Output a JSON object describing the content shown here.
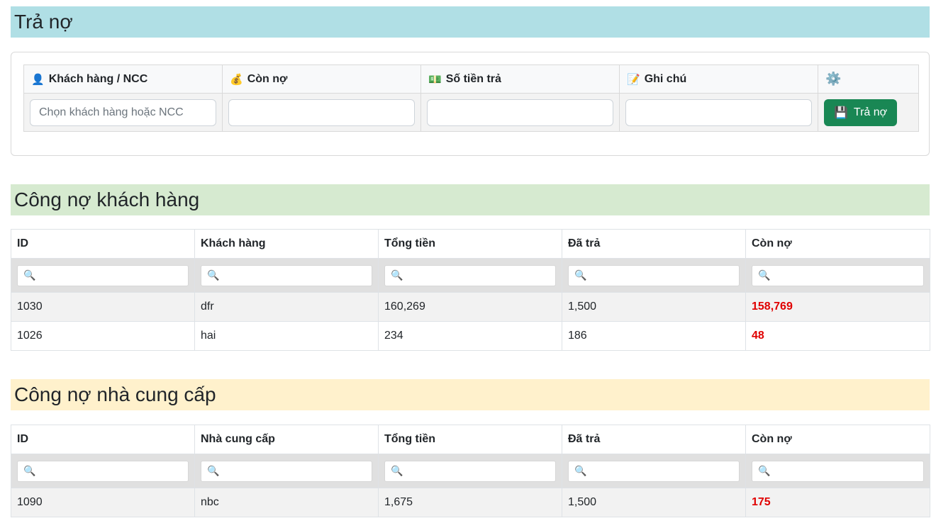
{
  "payment": {
    "title": "Trả nợ",
    "columns": [
      {
        "icon": "👤",
        "icon_name": "user-icon",
        "label": "Khách hàng / NCC"
      },
      {
        "icon": "💰",
        "icon_name": "money-bag-icon",
        "label": "Còn nợ"
      },
      {
        "icon": "💵",
        "icon_name": "banknote-icon",
        "label": "Số tiền trả"
      },
      {
        "icon": "📝",
        "icon_name": "memo-icon",
        "label": "Ghi chú"
      }
    ],
    "settings_icon": "⚙️",
    "customer_placeholder": "Chọn khách hàng hoặc NCC",
    "remaining_value": "",
    "amount_value": "",
    "note_value": "",
    "submit_icon": "💾",
    "submit_label": "Trả nợ",
    "submit_color": "#198754"
  },
  "customer_debt": {
    "title": "Công nợ khách hàng",
    "headers": [
      "ID",
      "Khách hàng",
      "Tổng tiền",
      "Đã trả",
      "Còn nợ"
    ],
    "rows": [
      [
        "1030",
        "dfr",
        "160,269",
        "1,500",
        "158,769"
      ],
      [
        "1026",
        "hai",
        "234",
        "186",
        "48"
      ]
    ]
  },
  "supplier_debt": {
    "title": "Công nợ nhà cung cấp",
    "headers": [
      "ID",
      "Nhà cung cấp",
      "Tổng tiền",
      "Đã trả",
      "Còn nợ"
    ],
    "rows": [
      [
        "1090",
        "nbc",
        "1,675",
        "1,500",
        "175"
      ]
    ]
  },
  "colors": {
    "pay_header_bg": "#b0dfe5",
    "customer_header_bg": "#d6ead0",
    "supplier_header_bg": "#fff1cc",
    "debt_text": "#e00000"
  }
}
